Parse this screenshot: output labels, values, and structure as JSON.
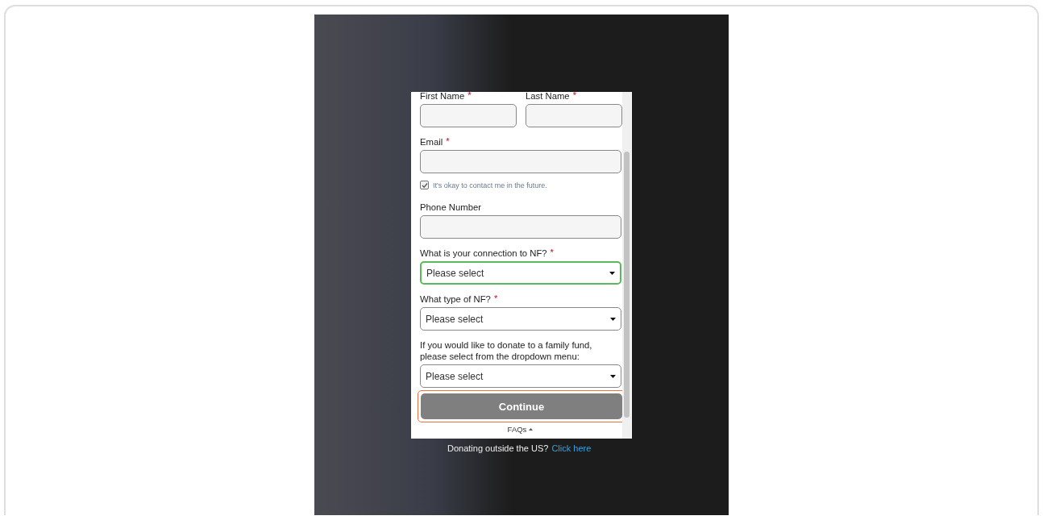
{
  "form": {
    "name_fields": [
      {
        "label": "First Name",
        "required_mark": "*"
      },
      {
        "label": "Last Name",
        "required_mark": "*"
      }
    ],
    "fields": [
      {
        "kind": "text",
        "label": "Email",
        "required_mark": "*",
        "highlighted": false
      },
      {
        "kind": "checkbox",
        "label": "It's okay to contact me in the future.",
        "checked": true
      },
      {
        "kind": "text",
        "label": "Phone Number",
        "highlighted": false
      },
      {
        "kind": "select",
        "label": "What is your connection to NF?",
        "required_mark": "*",
        "value": "Please select",
        "highlighted": true
      },
      {
        "kind": "select",
        "label": "What type of NF?",
        "required_mark": "*",
        "value": "Please select",
        "highlighted": false
      },
      {
        "kind": "select",
        "label": "If you would like to donate to a family fund, please select from the dropdown menu:",
        "value": "Please select",
        "highlighted": false
      }
    ],
    "continue_button": {
      "label": "Continue",
      "highlighted": true
    },
    "faqs_link": "FAQs"
  },
  "footer": {
    "text": "Donating outside the US?",
    "link": "Click here"
  }
}
